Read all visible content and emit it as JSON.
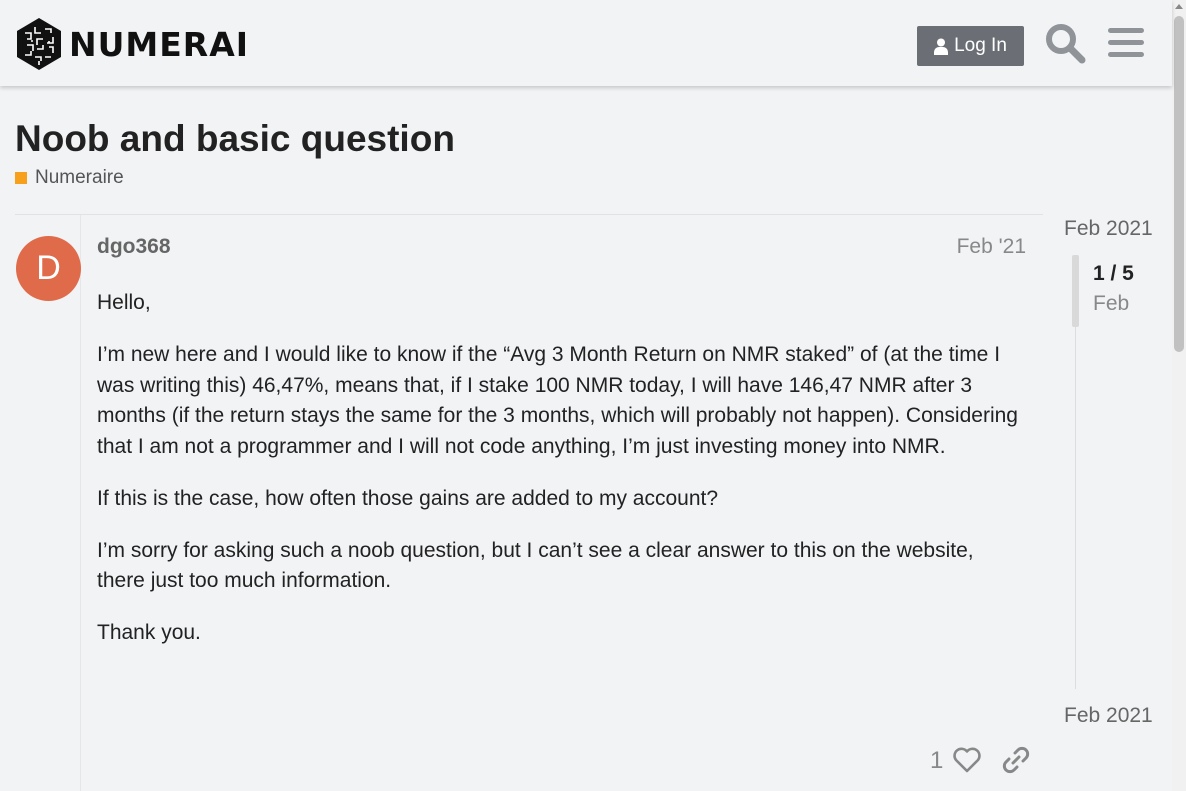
{
  "header": {
    "brand": "NUMERAI",
    "login_label": "Log In",
    "icons": {
      "search": "search-icon",
      "menu": "hamburger-menu-icon",
      "user": "user-icon"
    }
  },
  "topic": {
    "title": "Noob and basic question",
    "category": "Numeraire",
    "category_color": "#f6a01b"
  },
  "post": {
    "avatar_letter": "D",
    "avatar_color": "#e06b4a",
    "username": "dgo368",
    "date": "Feb '21",
    "paragraphs": [
      "Hello,",
      "I’m new here and I would like to know if the “Avg 3 Month Return on NMR staked” of (at the time I was writing this) 46,47%, means that, if I stake 100 NMR today, I will have 146,47 NMR after 3 months (if the return stays the same for the 3 months, which will probably not happen). Considering that I am not a programmer and I will not code anything, I’m just investing money into NMR.",
      "If this is the case, how often those gains are added to my account?",
      "I’m sorry for asking such a noob question, but I can’t see a clear answer to this on the website, there just too much information.",
      "Thank you."
    ],
    "like_count": "1"
  },
  "timeline": {
    "start": "Feb 2021",
    "position": "1 / 5",
    "month": "Feb",
    "end": "Feb 2021"
  }
}
